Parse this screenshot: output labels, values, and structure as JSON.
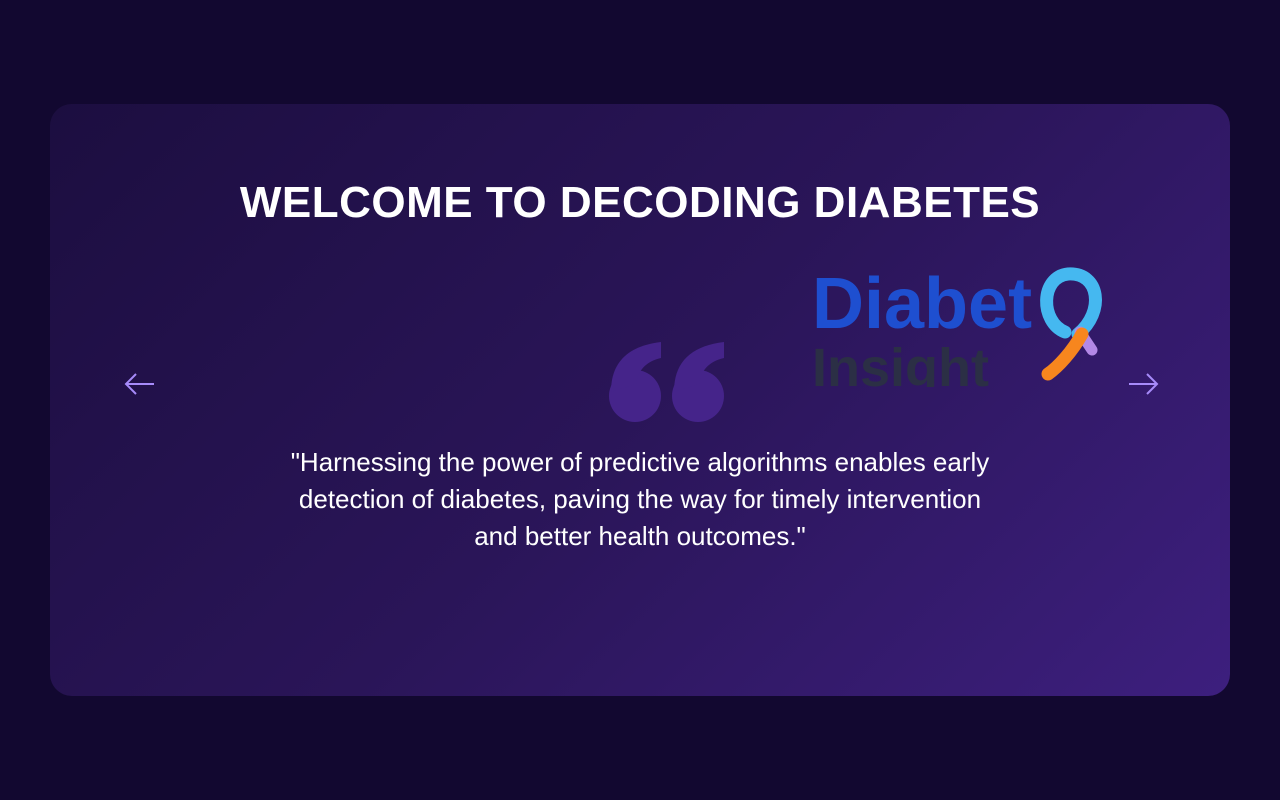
{
  "hero": {
    "title": "WELCOME TO DECODING DIABETES",
    "quote": "\"Harnessing the power of predictive algorithms enables early detection of diabetes, paving the way for timely intervention and better health outcomes.\"",
    "prev_icon": "arrow-left-icon",
    "next_icon": "arrow-right-icon",
    "logo_text": "Diabet Insight"
  },
  "colors": {
    "background": "#120830",
    "card_start": "#1c0e40",
    "card_end": "#3d1f7e",
    "accent": "#a78bfa",
    "quote_mark": "#45248a"
  }
}
